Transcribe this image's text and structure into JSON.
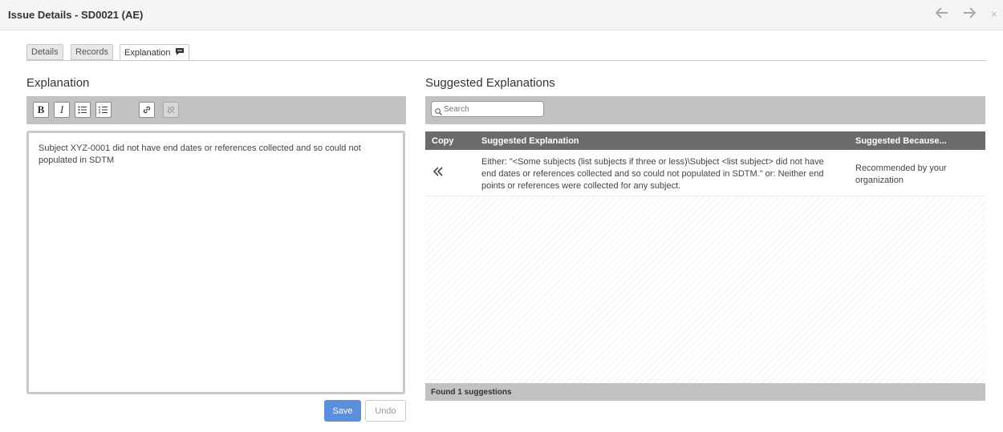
{
  "window": {
    "title": "Issue Details - SD0021 (AE)",
    "back_icon": "arrow-left-icon",
    "forward_icon": "arrow-right-icon",
    "close_label": "×"
  },
  "tabs": [
    {
      "label": "Details",
      "active": false
    },
    {
      "label": "Records",
      "active": false
    },
    {
      "label": "Explanation",
      "active": true,
      "icon": "comment-icon"
    }
  ],
  "explanation": {
    "heading": "Explanation",
    "toolbar": [
      {
        "icon": "bold-icon",
        "glyph": "B"
      },
      {
        "icon": "italic-icon",
        "glyph": "I"
      },
      {
        "icon": "bullet-list-icon"
      },
      {
        "icon": "numbered-list-icon"
      },
      {
        "icon": "link-icon"
      },
      {
        "icon": "unlink-icon",
        "disabled": true
      }
    ],
    "text": "Subject XYZ-0001 did not have end dates or references collected and so could not populated in SDTM",
    "save_label": "Save",
    "undo_label": "Undo"
  },
  "suggested": {
    "heading": "Suggested Explanations",
    "search_placeholder": "Search",
    "columns": [
      "Copy",
      "Suggested Explanation",
      "Suggested Because..."
    ],
    "rows": [
      {
        "copy_icon": "double-chevron-left-icon",
        "explanation": "Either: \"<Some subjects (list subjects if three or less)\\Subject <list subject> did not have end dates or references collected and so could not populated in SDTM.\" or: Neither end points or references were collected for any subject.",
        "because": "Recommended by your organization"
      }
    ],
    "footer": "Found 1 suggestions"
  },
  "colors": {
    "accent": "#5b8fdc",
    "header_dark": "#6b6b6b",
    "toolbar_gray": "#c2c2c2"
  }
}
